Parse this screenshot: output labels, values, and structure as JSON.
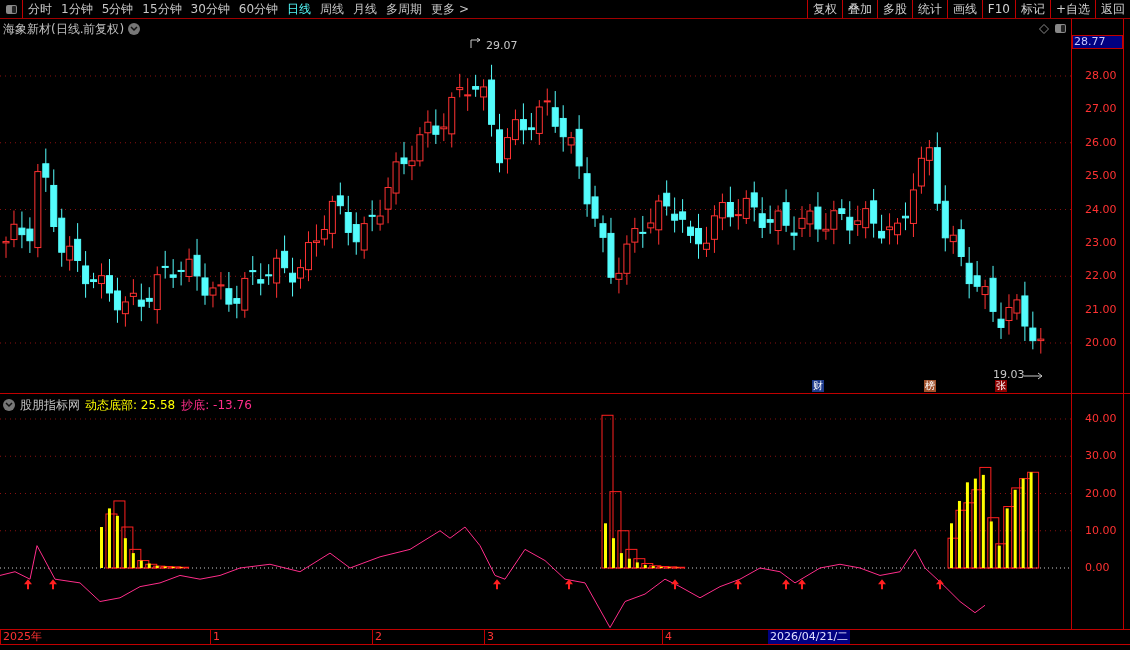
{
  "toolbar": {
    "periods": [
      {
        "label": "分时",
        "selected": false
      },
      {
        "label": "1分钟",
        "selected": false
      },
      {
        "label": "5分钟",
        "selected": false
      },
      {
        "label": "15分钟",
        "selected": false
      },
      {
        "label": "30分钟",
        "selected": false
      },
      {
        "label": "60分钟",
        "selected": false
      },
      {
        "label": "日线",
        "selected": true
      },
      {
        "label": "周线",
        "selected": false
      },
      {
        "label": "月线",
        "selected": false
      },
      {
        "label": "多周期",
        "selected": false
      },
      {
        "label": "更多 >",
        "selected": false
      }
    ],
    "buttons": [
      "复权",
      "叠加",
      "多股",
      "统计",
      "画线",
      "F10",
      "标记",
      "+自选",
      "返回"
    ]
  },
  "main_chart": {
    "title": "海象新材(日线.前复权)",
    "current_price": "28.77",
    "y_labels": [
      "28.00",
      "27.00",
      "26.00",
      "25.00",
      "24.00",
      "23.00",
      "22.00",
      "21.00",
      "20.00"
    ],
    "high_label": "29.07",
    "low_label": "19.03",
    "event_badges": [
      {
        "text": "财",
        "color": "#1e3a8a"
      },
      {
        "text": "榜",
        "color": "#a0522d"
      },
      {
        "text": "张",
        "color": "#8b0000"
      }
    ]
  },
  "indicator": {
    "name": "股朋指标网",
    "values": [
      {
        "label": "动态底部: 25.58",
        "color": "#ffff00"
      },
      {
        "label": "抄底: -13.76",
        "color": "#ff2d8a"
      }
    ],
    "y_labels": [
      "40.00",
      "30.00",
      "20.00",
      "10.00",
      "0.00"
    ]
  },
  "time_axis": {
    "labels": [
      "2025年",
      "1",
      "2",
      "3",
      "4"
    ],
    "cursor_date": "2026/04/21/二"
  }
}
